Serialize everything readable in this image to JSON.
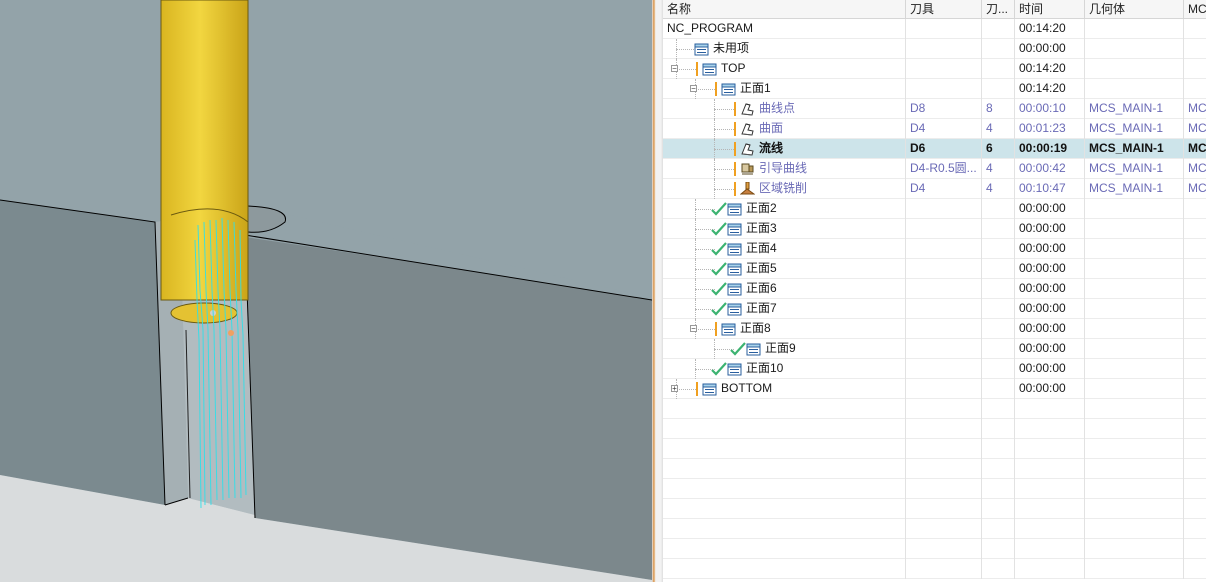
{
  "columns": [
    "名称",
    "刀具",
    "刀...",
    "时间",
    "几何体",
    "MC"
  ],
  "rows": [
    {
      "name": "NC_PROGRAM",
      "tool": "",
      "tnum": "",
      "time": "00:14:20",
      "geom": "",
      "mc": "",
      "icon": "none",
      "status": "none",
      "style": "normal",
      "expander": "none",
      "depth": 0
    },
    {
      "name": "未用项",
      "tool": "",
      "tnum": "",
      "time": "00:00:00",
      "geom": "",
      "mc": "",
      "icon": "folder",
      "status": "none",
      "style": "normal",
      "expander": "none",
      "depth": 1
    },
    {
      "name": "TOP",
      "tool": "",
      "tnum": "",
      "time": "00:14:20",
      "geom": "",
      "mc": "",
      "icon": "folder",
      "status": "warning",
      "style": "normal",
      "expander": "minus",
      "depth": 1
    },
    {
      "name": "正面1",
      "tool": "",
      "tnum": "",
      "time": "00:14:20",
      "geom": "",
      "mc": "",
      "icon": "folder",
      "status": "warning",
      "style": "normal",
      "expander": "minus",
      "depth": 2
    },
    {
      "name": "曲线点",
      "tool": "D8",
      "tnum": "8",
      "time": "00:00:10",
      "geom": "MCS_MAIN-1",
      "mc": "MC",
      "icon": "operation",
      "status": "warning",
      "style": "blue",
      "expander": "none",
      "depth": 3
    },
    {
      "name": "曲面",
      "tool": "D4",
      "tnum": "4",
      "time": "00:01:23",
      "geom": "MCS_MAIN-1",
      "mc": "MC",
      "icon": "operation",
      "status": "warning",
      "style": "blue",
      "expander": "none",
      "depth": 3
    },
    {
      "name": "流线",
      "tool": "D6",
      "tnum": "6",
      "time": "00:00:19",
      "geom": "MCS_MAIN-1",
      "mc": "MC",
      "icon": "operation",
      "status": "warning",
      "style": "bold",
      "expander": "none",
      "depth": 3,
      "selected": true
    },
    {
      "name": "引导曲线",
      "tool": "D4-R0.5圆...",
      "tnum": "4",
      "time": "00:00:42",
      "geom": "MCS_MAIN-1",
      "mc": "MC",
      "icon": "operation-guide",
      "status": "warning",
      "style": "blue",
      "expander": "none",
      "depth": 3
    },
    {
      "name": "区域铣削",
      "tool": "D4",
      "tnum": "4",
      "time": "00:10:47",
      "geom": "MCS_MAIN-1",
      "mc": "MC",
      "icon": "operation-area",
      "status": "warning",
      "style": "blue",
      "expander": "none",
      "depth": 3
    },
    {
      "name": "正面2",
      "tool": "",
      "tnum": "",
      "time": "00:00:00",
      "geom": "",
      "mc": "",
      "icon": "folder",
      "status": "check",
      "style": "normal",
      "expander": "none",
      "depth": 2
    },
    {
      "name": "正面3",
      "tool": "",
      "tnum": "",
      "time": "00:00:00",
      "geom": "",
      "mc": "",
      "icon": "folder",
      "status": "check",
      "style": "normal",
      "expander": "none",
      "depth": 2
    },
    {
      "name": "正面4",
      "tool": "",
      "tnum": "",
      "time": "00:00:00",
      "geom": "",
      "mc": "",
      "icon": "folder",
      "status": "check",
      "style": "normal",
      "expander": "none",
      "depth": 2
    },
    {
      "name": "正面5",
      "tool": "",
      "tnum": "",
      "time": "00:00:00",
      "geom": "",
      "mc": "",
      "icon": "folder",
      "status": "check",
      "style": "normal",
      "expander": "none",
      "depth": 2
    },
    {
      "name": "正面6",
      "tool": "",
      "tnum": "",
      "time": "00:00:00",
      "geom": "",
      "mc": "",
      "icon": "folder",
      "status": "check",
      "style": "normal",
      "expander": "none",
      "depth": 2
    },
    {
      "name": "正面7",
      "tool": "",
      "tnum": "",
      "time": "00:00:00",
      "geom": "",
      "mc": "",
      "icon": "folder",
      "status": "check",
      "style": "normal",
      "expander": "none",
      "depth": 2
    },
    {
      "name": "正面8",
      "tool": "",
      "tnum": "",
      "time": "00:00:00",
      "geom": "",
      "mc": "",
      "icon": "folder",
      "status": "warning",
      "style": "normal",
      "expander": "minus",
      "depth": 2
    },
    {
      "name": "正面9",
      "tool": "",
      "tnum": "",
      "time": "00:00:00",
      "geom": "",
      "mc": "",
      "icon": "folder",
      "status": "check",
      "style": "normal",
      "expander": "none",
      "depth": 3
    },
    {
      "name": "正面10",
      "tool": "",
      "tnum": "",
      "time": "00:00:00",
      "geom": "",
      "mc": "",
      "icon": "folder",
      "status": "check",
      "style": "normal",
      "expander": "none",
      "depth": 2
    },
    {
      "name": "BOTTOM",
      "tool": "",
      "tnum": "",
      "time": "00:00:00",
      "geom": "",
      "mc": "",
      "icon": "folder",
      "status": "warning",
      "style": "normal",
      "expander": "plus",
      "depth": 1
    }
  ],
  "empty_rows": 9,
  "colors": {
    "viewport_bg": "#93a3a9",
    "tool_yellow": "#e8c830",
    "toolpath_cyan": "#2ee0ea",
    "selected_row": "#cde4ea",
    "warning": "#f0a020",
    "check": "#3cb371",
    "link_text": "#6a6ab6"
  }
}
